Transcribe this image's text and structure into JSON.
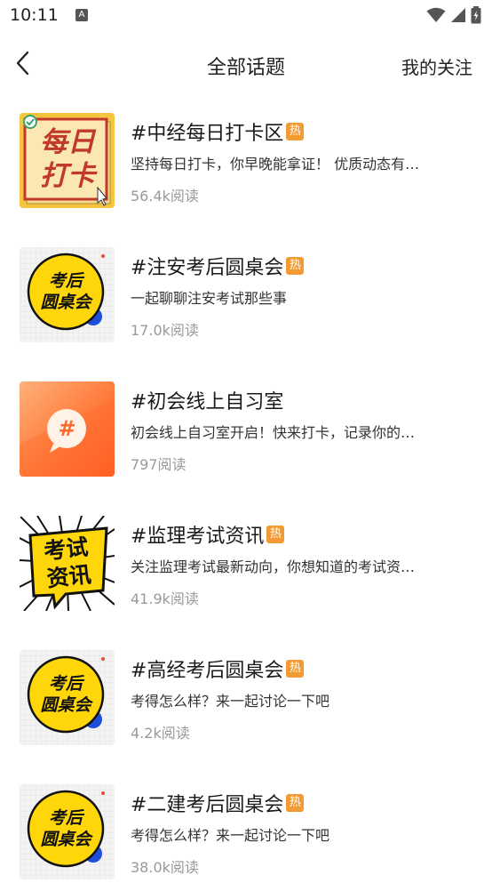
{
  "status_bar": {
    "time": "10:11",
    "notification_icon": "A"
  },
  "header": {
    "title": "全部话题",
    "follow_label": "我的关注"
  },
  "topics": [
    {
      "title": "#中经每日打卡区",
      "hot": "热",
      "desc": "坚持每日打卡，你早晚能拿证！ 优质动态有…",
      "reads": "56.4k阅读",
      "thumb_line1": "每日",
      "thumb_line2": "打卡"
    },
    {
      "title": "#注安考后圆桌会",
      "hot": "热",
      "desc": "一起聊聊注安考试那些事",
      "reads": "17.0k阅读",
      "thumb_line1": "考后",
      "thumb_line2": "圆桌会"
    },
    {
      "title": "#初会线上自习室",
      "hot": "",
      "desc": "初会线上自习室开启！快来打卡，记录你的…",
      "reads": "797阅读",
      "thumb_line1": "#",
      "thumb_line2": ""
    },
    {
      "title": "#监理考试资讯",
      "hot": "热",
      "desc": "关注监理考试最新动向，你想知道的考试资…",
      "reads": "41.9k阅读",
      "thumb_line1": "考试",
      "thumb_line2": "资讯"
    },
    {
      "title": "#高经考后圆桌会",
      "hot": "热",
      "desc": "考得怎么样？来一起讨论一下吧",
      "reads": "4.2k阅读",
      "thumb_line1": "考后",
      "thumb_line2": "圆桌会"
    },
    {
      "title": "#二建考后圆桌会",
      "hot": "热",
      "desc": "考得怎么样？来一起讨论一下吧",
      "reads": "38.0k阅读",
      "thumb_line1": "考后",
      "thumb_line2": "圆桌会"
    }
  ],
  "colors": {
    "hot_badge": "#f29a33",
    "checkin_bg": "#f5c542",
    "checkin_text": "#c0392b",
    "study_orange": "#ff6a2a",
    "roundtable_yellow": "#ffd60a",
    "roundtable_blue": "#1f4fd8"
  },
  "icons": {
    "back": "chevron-left-icon",
    "wifi": "wifi-icon",
    "signal": "signal-icon",
    "battery": "battery-icon"
  }
}
